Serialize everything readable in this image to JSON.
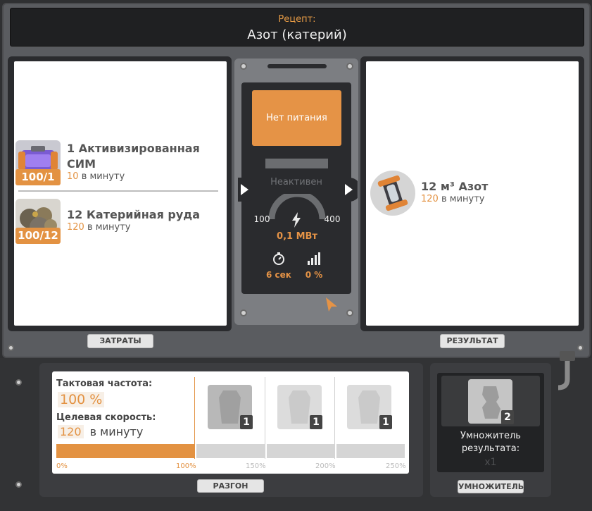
{
  "header": {
    "recipe_label": "Рецепт:",
    "recipe_name": "Азот (катерий)"
  },
  "inputs": {
    "items": [
      {
        "title": "1 Активизированная СИМ",
        "badge": "100/1",
        "rate_value": "10",
        "rate_unit": "в минуту",
        "icon": "activated-sim-icon"
      },
      {
        "title": "12 Катерийная руда",
        "badge": "100/12",
        "rate_value": "120",
        "rate_unit": "в минуту",
        "icon": "caterium-ore-icon"
      }
    ],
    "tab": "ЗАТРАТЫ"
  },
  "machine": {
    "status_button": "Нет питания",
    "state": "Неактивен",
    "gauge_min": "100",
    "gauge_max": "400",
    "power": "0,1 МВт",
    "cycle_time": "6 сек",
    "productivity": "0 %"
  },
  "output": {
    "title": "12 м³ Азот",
    "rate_value": "120",
    "rate_unit": "в минуту",
    "icon": "nitrogen-canister-icon",
    "tab": "РЕЗУЛЬТАТ"
  },
  "overclock": {
    "clock_label": "Тактовая частота:",
    "clock_value": "100 %",
    "target_label": "Целевая скорость:",
    "target_value": "120",
    "target_unit": "в минуту",
    "bar_fill": 1.0,
    "ticks": [
      "0%",
      "100%",
      "150%",
      "200%",
      "250%"
    ],
    "shard_slots": [
      "1",
      "1",
      "1"
    ],
    "tab": "РАЗГОН"
  },
  "multiplier": {
    "slot_count": "2",
    "label": "Умножитель результата:",
    "value": "x1",
    "tab": "УМНОЖИТЕЛЬ"
  },
  "colors": {
    "accent": "#e39242",
    "panel": "#2a2b2e",
    "frame": "#5a5c60"
  }
}
